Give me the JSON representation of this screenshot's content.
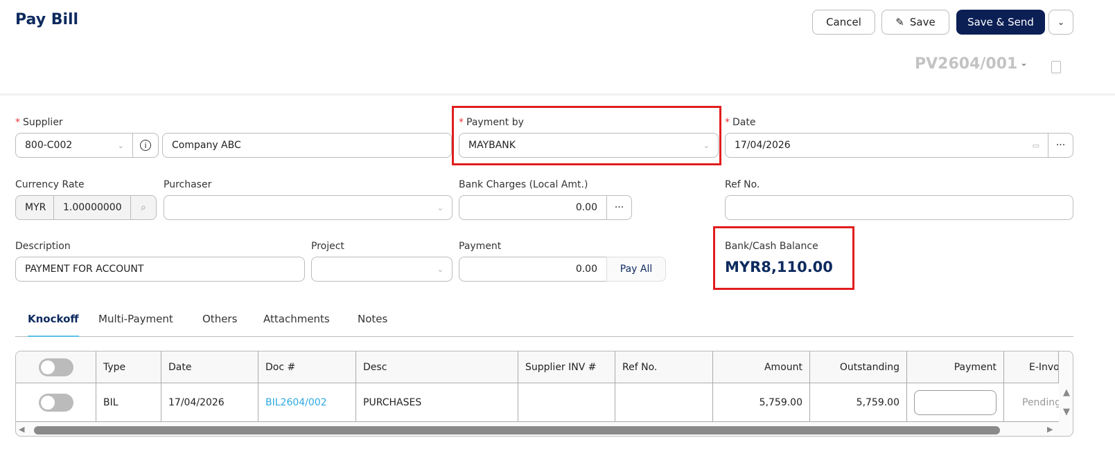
{
  "header": {
    "title": "Pay Bill",
    "cancel": "Cancel",
    "save": "Save",
    "save_send": "Save & Send",
    "doc_no": "PV2604/001"
  },
  "form": {
    "supplier": {
      "label": "Supplier",
      "code": "800-C002",
      "name": "Company ABC"
    },
    "payment_by": {
      "label": "Payment by",
      "value": "MAYBANK"
    },
    "date": {
      "label": "Date",
      "value": "17/04/2026"
    },
    "currency_rate": {
      "label": "Currency Rate",
      "currency": "MYR",
      "rate": "1.00000000"
    },
    "purchaser": {
      "label": "Purchaser",
      "value": ""
    },
    "bank_charges": {
      "label": "Bank Charges (Local Amt.)",
      "value": "0.00"
    },
    "ref_no": {
      "label": "Ref No.",
      "value": ""
    },
    "description": {
      "label": "Description",
      "value": "PAYMENT FOR ACCOUNT"
    },
    "project": {
      "label": "Project",
      "value": ""
    },
    "payment": {
      "label": "Payment",
      "value": "0.00",
      "pay_all": "Pay All"
    },
    "balance": {
      "label": "Bank/Cash Balance",
      "value": "MYR8,110.00"
    }
  },
  "tabs": [
    "Knockoff",
    "Multi-Payment",
    "Others",
    "Attachments",
    "Notes"
  ],
  "table": {
    "headers": [
      "Type",
      "Date",
      "Doc #",
      "Desc",
      "Supplier INV #",
      "Ref No.",
      "Amount",
      "Outstanding",
      "Payment",
      "E-Invoice"
    ],
    "rows": [
      {
        "type": "BIL",
        "date": "17/04/2026",
        "doc": "BIL2604/002",
        "desc": "PURCHASES",
        "supplier_inv": "",
        "ref": "",
        "amount": "5,759.00",
        "outstanding": "5,759.00",
        "payment": "",
        "einvoice": "Pending"
      }
    ]
  },
  "colors": {
    "primary": "#0b1f55",
    "link": "#2ea8e0",
    "highlight": "#e11d1d"
  }
}
